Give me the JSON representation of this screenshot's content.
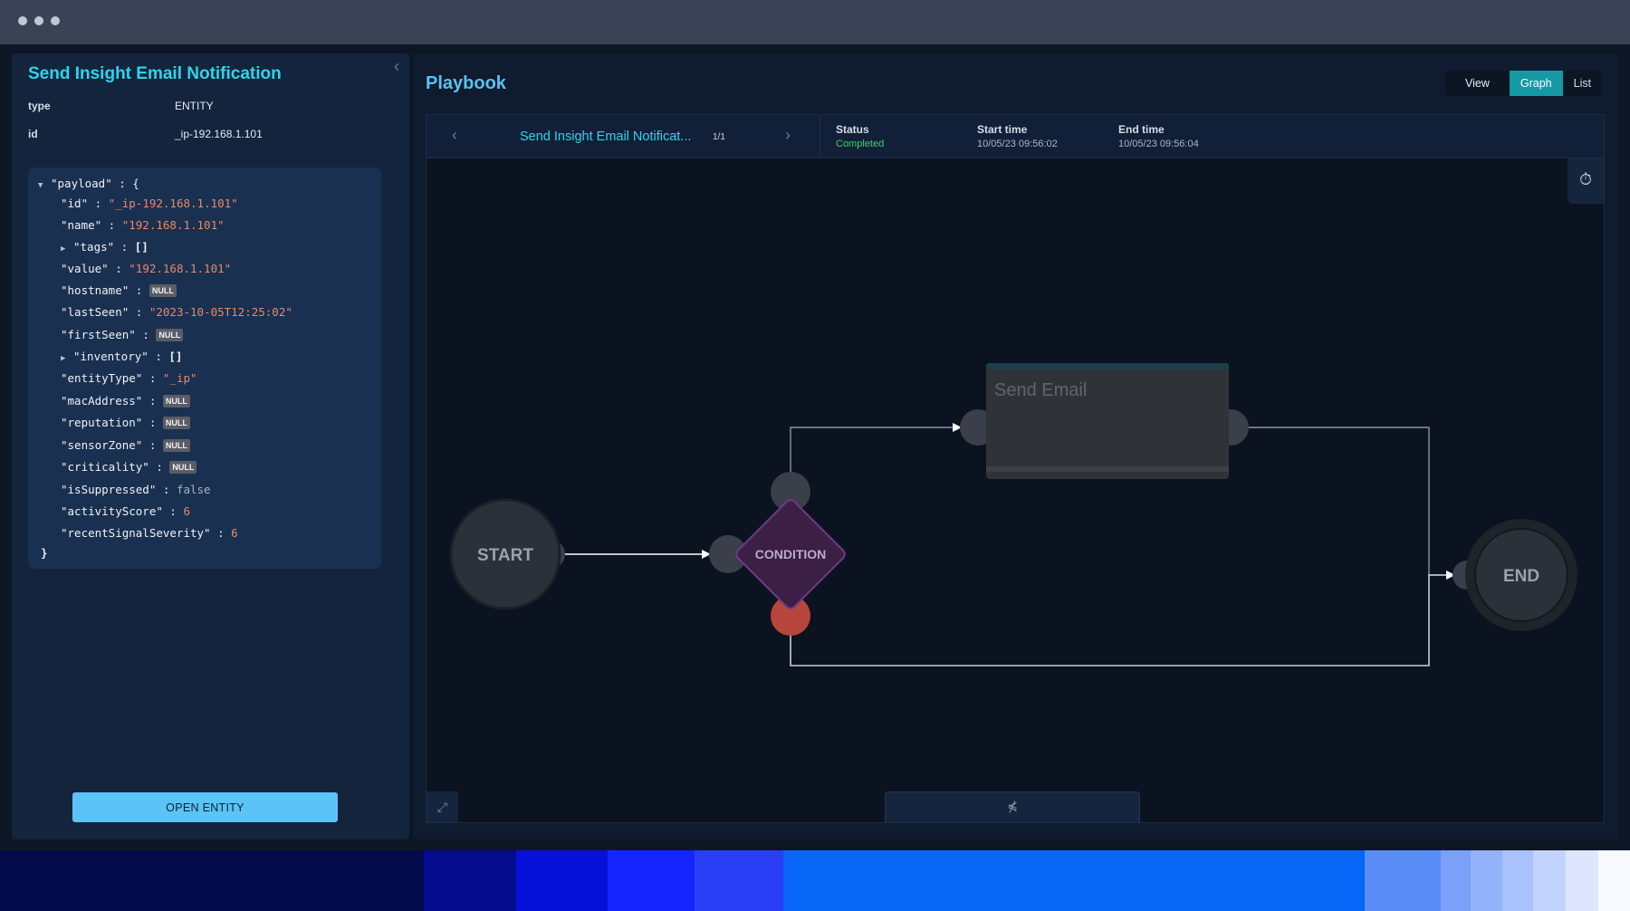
{
  "entity": {
    "title": "Send Insight Email Notification",
    "type_label": "type",
    "type_value": "ENTITY",
    "id_label": "id",
    "id_value": "_ip-192.168.1.101",
    "open_button": "OPEN ENTITY"
  },
  "payload": {
    "root_key": "\"payload\"",
    "fields": {
      "id": "\"_ip-192.168.1.101\"",
      "name": "\"192.168.1.101\"",
      "tags": "[]",
      "value": "\"192.168.1.101\"",
      "hostname": "NULL",
      "lastSeen": "\"2023-10-05T12:25:02\"",
      "firstSeen": "NULL",
      "inventory": "[]",
      "entityType": "\"_ip\"",
      "macAddress": "NULL",
      "reputation": "NULL",
      "sensorZone": "NULL",
      "criticality": "NULL",
      "isSuppressed": "false",
      "activityScore": "6",
      "recentSignalSeverity": "6"
    }
  },
  "playbook": {
    "title": "Playbook",
    "view_label": "View",
    "graph_label": "Graph",
    "list_label": "List",
    "active_view": "Graph",
    "run_name": "Send Insight Email Notificat...",
    "run_count": "1/1",
    "status_label": "Status",
    "status_value": "Completed",
    "start_label": "Start time",
    "start_value": "10/05/23 09:56:02",
    "end_label": "End time",
    "end_value": "10/05/23 09:56:04"
  },
  "graph": {
    "start_label": "START",
    "condition_label": "CONDITION",
    "action_label": "Send Email",
    "end_label": "END"
  },
  "icons": {
    "collapse": "chevron-left-icon",
    "prev": "chevron-left-icon",
    "next": "chevron-right-icon",
    "history": "history-icon",
    "fit": "expand-icon",
    "drawer": "collapse-arrows-icon"
  },
  "colors": {
    "accent_cyan": "#2ed5e8",
    "playbook_blue": "#58c3f0",
    "graph_active": "#159aa5",
    "status_ok": "#3ecf6f",
    "button_blue": "#5cc3f6",
    "condition_fill": "#3b1f45",
    "condition_border": "#6e3a86",
    "false_port": "#b8453b"
  }
}
